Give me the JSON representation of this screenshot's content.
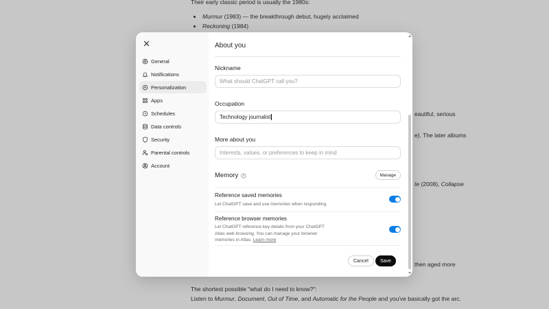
{
  "background": {
    "line1": "Their early classic period is usually the 1980s:",
    "bullet1_title": "Murmur",
    "bullet1_rest": " (1983) — the breakthrough debut, hugely acclaimed",
    "bullet2_title": "Reckoning",
    "bullet2_rest": " (1984)",
    "frag1": "eautiful, serious",
    "frag2": "e). The later albums",
    "frag3_a": "te",
    "frag3_b": " (2008), ",
    "frag3_c": "Collapse",
    "frag4": "then aged more",
    "bottom1": "The shortest possible \"what do I need to know?\":",
    "bottom2_pre": "Listen to ",
    "bottom2_t1": "Murmur",
    "bottom2_s1": ", ",
    "bottom2_t2": "Document",
    "bottom2_s2": ", ",
    "bottom2_t3": "Out of Time",
    "bottom2_s3": ", and ",
    "bottom2_t4": "Automatic for the People",
    "bottom2_post": " and you've basically got the arc."
  },
  "sidebar": {
    "items": [
      {
        "label": "General",
        "icon": "gear-icon"
      },
      {
        "label": "Notifications",
        "icon": "bell-icon"
      },
      {
        "label": "Personalization",
        "icon": "personalization-icon"
      },
      {
        "label": "Apps",
        "icon": "apps-grid-icon"
      },
      {
        "label": "Schedules",
        "icon": "clock-icon"
      },
      {
        "label": "Data controls",
        "icon": "database-icon"
      },
      {
        "label": "Security",
        "icon": "shield-icon"
      },
      {
        "label": "Parental controls",
        "icon": "parental-icon"
      },
      {
        "label": "Account",
        "icon": "account-icon"
      }
    ],
    "active_index": 2
  },
  "panel": {
    "title": "About you",
    "nickname": {
      "label": "Nickname",
      "value": "",
      "placeholder": "What should ChatGPT call you?"
    },
    "occupation": {
      "label": "Occupation",
      "value": "Technology journalist",
      "placeholder": ""
    },
    "more": {
      "label": "More about you",
      "value": "",
      "placeholder": "Interests, values, or preferences to keep in mind"
    },
    "memory": {
      "title": "Memory",
      "manage_label": "Manage",
      "saved": {
        "title": "Reference saved memories",
        "desc": "Let ChatGPT save and use memories when responding.",
        "enabled": true
      },
      "browser": {
        "title": "Reference browser memories",
        "desc": "Let ChatGPT reference key details from your ChatGPT Atlas web browsing. You can manage your browser memories in Atlas.",
        "link": "Learn more",
        "enabled": true
      }
    },
    "cancel_label": "Cancel",
    "save_label": "Save"
  },
  "colors": {
    "toggle_on": "#0b7ee5",
    "save_bg": "#0d0d0d",
    "sidebar_bg": "#f9f9f9",
    "active_item_bg": "#ececec"
  }
}
